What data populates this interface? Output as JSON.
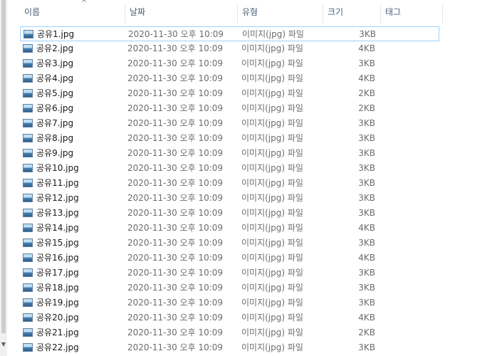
{
  "columns": {
    "name": "이름",
    "date": "날짜",
    "type": "유형",
    "size": "크기",
    "tags": "태그"
  },
  "sort_icon": "chevron-up-icon",
  "file_icon": "image-file-icon",
  "rows": [
    {
      "name": "공유1.jpg",
      "date": "2020-11-30 오후 10:09",
      "type": "이미지(jpg) 파일",
      "size": "3KB"
    },
    {
      "name": "공유2.jpg",
      "date": "2020-11-30 오후 10:09",
      "type": "이미지(jpg) 파일",
      "size": "4KB"
    },
    {
      "name": "공유3.jpg",
      "date": "2020-11-30 오후 10:09",
      "type": "이미지(jpg) 파일",
      "size": "3KB"
    },
    {
      "name": "공유4.jpg",
      "date": "2020-11-30 오후 10:09",
      "type": "이미지(jpg) 파일",
      "size": "4KB"
    },
    {
      "name": "공유5.jpg",
      "date": "2020-11-30 오후 10:09",
      "type": "이미지(jpg) 파일",
      "size": "2KB"
    },
    {
      "name": "공유6.jpg",
      "date": "2020-11-30 오후 10:09",
      "type": "이미지(jpg) 파일",
      "size": "2KB"
    },
    {
      "name": "공유7.jpg",
      "date": "2020-11-30 오후 10:09",
      "type": "이미지(jpg) 파일",
      "size": "3KB"
    },
    {
      "name": "공유8.jpg",
      "date": "2020-11-30 오후 10:09",
      "type": "이미지(jpg) 파일",
      "size": "3KB"
    },
    {
      "name": "공유9.jpg",
      "date": "2020-11-30 오후 10:09",
      "type": "이미지(jpg) 파일",
      "size": "3KB"
    },
    {
      "name": "공유10.jpg",
      "date": "2020-11-30 오후 10:09",
      "type": "이미지(jpg) 파일",
      "size": "3KB"
    },
    {
      "name": "공유11.jpg",
      "date": "2020-11-30 오후 10:09",
      "type": "이미지(jpg) 파일",
      "size": "3KB"
    },
    {
      "name": "공유12.jpg",
      "date": "2020-11-30 오후 10:09",
      "type": "이미지(jpg) 파일",
      "size": "3KB"
    },
    {
      "name": "공유13.jpg",
      "date": "2020-11-30 오후 10:09",
      "type": "이미지(jpg) 파일",
      "size": "3KB"
    },
    {
      "name": "공유14.jpg",
      "date": "2020-11-30 오후 10:09",
      "type": "이미지(jpg) 파일",
      "size": "4KB"
    },
    {
      "name": "공유15.jpg",
      "date": "2020-11-30 오후 10:09",
      "type": "이미지(jpg) 파일",
      "size": "3KB"
    },
    {
      "name": "공유16.jpg",
      "date": "2020-11-30 오후 10:09",
      "type": "이미지(jpg) 파일",
      "size": "4KB"
    },
    {
      "name": "공유17.jpg",
      "date": "2020-11-30 오후 10:09",
      "type": "이미지(jpg) 파일",
      "size": "3KB"
    },
    {
      "name": "공유18.jpg",
      "date": "2020-11-30 오후 10:09",
      "type": "이미지(jpg) 파일",
      "size": "3KB"
    },
    {
      "name": "공유19.jpg",
      "date": "2020-11-30 오후 10:09",
      "type": "이미지(jpg) 파일",
      "size": "3KB"
    },
    {
      "name": "공유20.jpg",
      "date": "2020-11-30 오후 10:09",
      "type": "이미지(jpg) 파일",
      "size": "4KB"
    },
    {
      "name": "공유21.jpg",
      "date": "2020-11-30 오후 10:09",
      "type": "이미지(jpg) 파일",
      "size": "2KB"
    },
    {
      "name": "공유22.jpg",
      "date": "2020-11-30 오후 10:09",
      "type": "이미지(jpg) 파일",
      "size": "3KB"
    }
  ],
  "selected_row": 0
}
